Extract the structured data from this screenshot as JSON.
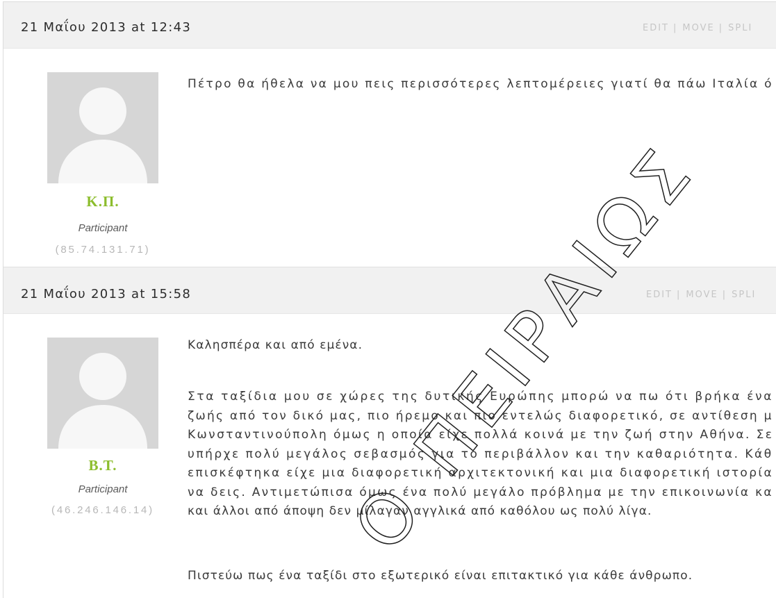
{
  "watermark": "Ο ΠΕΙΡΑΙΩΣ",
  "admin_separator": "|",
  "replies": [
    {
      "date": "21 Μαΐου 2013 at 12:43",
      "admin": {
        "edit": "EDIT",
        "move": "MOVE",
        "split": "SPLI"
      },
      "author": {
        "name": "Κ.Π.",
        "role": "Participant",
        "ip": "(85.74.131.71)",
        "avatar_icon": "user-silhouette-icon"
      },
      "paragraphs": [
        [
          "Πέτρο θα ήθελα να μου πεις περισσότερες λεπτομέρειες γιατί θα πάω Ιταλία ό"
        ]
      ]
    },
    {
      "date": "21 Μαΐου 2013 at 15:58",
      "admin": {
        "edit": "EDIT",
        "move": "MOVE",
        "split": "SPLI"
      },
      "author": {
        "name": "Β.Τ.",
        "role": "Participant",
        "ip": "(46.246.146.14)",
        "avatar_icon": "user-silhouette-icon"
      },
      "paragraphs": [
        [
          "Καλησπέρα και από εμένα."
        ],
        [
          "Στα ταξίδια μου σε χώρες της δυτικής Ευρώπης μπορώ να πω ότι βρήκα ένα",
          "ζωής από τον δικό μας, πιο ήρεμο και πιο εντελώς διαφορετικό, σε αντίθεση μ",
          "Κωνσταντινούπολη όμως η οποία είχε πολλά κοινά με την ζωή στην Αθήνα. Σε",
          "υπήρχε πολύ μεγάλος σεβασμός για το περιβάλλον και την καθαριότητα. Κάθ",
          "επισκέφτηκα είχε μια διαφορετική αρχιτεκτονική και μια διαφορετική ιστορία",
          "να δεις. Αντιμετώπισα όμως ένα πολύ μεγάλο πρόβλημα με την επικοινωνία κα",
          "και άλλοι από άποψη δεν μίλαγαν αγγλικά από καθόλου ως πολύ λίγα."
        ],
        [
          "Πιστεύω πως ένα ταξίδι στο εξωτερικό είναι επιτακτικό για κάθε άνθρωπο."
        ]
      ]
    }
  ],
  "colors": {
    "header_bg": "#f1f1f1",
    "author_name": "#8cbd2d",
    "admin_link": "#c6c6c6",
    "text": "#3a3a3a",
    "muted": "#b7b7b7",
    "avatar_bg": "#d6d6d6"
  }
}
